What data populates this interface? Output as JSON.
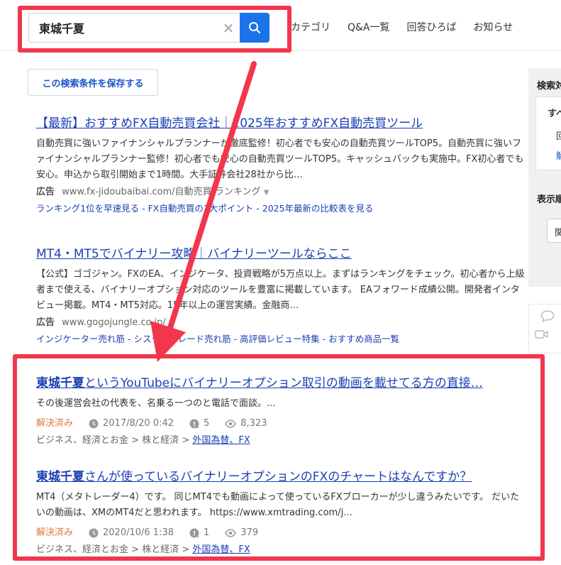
{
  "search": {
    "value": "東城千夏",
    "clear_icon": "×"
  },
  "nav": {
    "items": [
      "カテゴリ",
      "Q&A一覧",
      "回答ひろば",
      "お知らせ"
    ]
  },
  "save_search_label": "この検索条件を保存する",
  "ads": [
    {
      "title": "【最新】おすすめFX自動売買会社｜2025年おすすめFX自動売買ツール",
      "desc": "自動売買に強いファイナンシャルプランナーが徹底監修！初心者でも安心の自動売買ツールTOP5。自動売買に強いファイナンシャルプランナー監修！初心者でも安心の自動売買ツールTOP5。キャッシュバックも実施中。FX初心者でも安心。申込から取引開始まで1時間。大手証券会社28社から比…",
      "ad_label": "広告",
      "url": "www.fx-jidoubaibai.com/自動売買/ランキング",
      "links": [
        "ランキング1位を早速見る",
        "FX自動売買の3大ポイント",
        "2025年最新の比較表を見る"
      ]
    },
    {
      "title": "MT4・MT5でバイナリー攻略｜バイナリーツールならここ",
      "desc": "【公式】ゴゴジャン。FXのEA、インジケータ、投資戦略が5万点以上。まずはランキングをチェック。初心者から上級者まで使える、バイナリーオプション対応のツールを豊富に掲載しています。 EAフォワード成績公開。開発者インタビュー掲載。MT4・MT5対応。15年以上の運営実績。金融商…",
      "ad_label": "広告",
      "url": "www.gogojungle.co.jp/",
      "links": [
        "インジケーター売れ筋",
        "システムトレード売れ筋",
        "高評価レビュー特集",
        "おすすめ商品一覧"
      ]
    }
  ],
  "link_separator": " - ",
  "questions": [
    {
      "title_highlight": "東城千夏",
      "title_rest": "というYouTubeにバイナリーオプション取引の動画を載せてる方の直接…",
      "desc": "その後運営会社の代表を、名乗る一つのと電話で面談。...",
      "status": "解決済み",
      "date": "2017/8/20 0:42",
      "answers": "5",
      "views": "8,323",
      "crumbs": [
        "ビジネス、経済とお金",
        "株と経済"
      ],
      "category_link": "外国為替、FX"
    },
    {
      "title_highlight": "東城千夏",
      "title_rest": "さんが使っているバイナリーオプションのFXのチャートはなんですか？",
      "desc": "MT4（メタトレーダー4）です。 同じMT4でも動画によって使っているFXブローカーが少し違うみたいです。 だいたいの動画は、XMのMT4だと思われます。 https://www.xmtrading.com/j...",
      "status": "解決済み",
      "date": "2020/10/6 1:38",
      "answers": "1",
      "views": "379",
      "crumbs": [
        "ビジネス、経済とお金",
        "株と経済"
      ],
      "category_link": "外国為替、FX"
    }
  ],
  "crumb_separator": " > ",
  "sidebar": {
    "heading": "検索対",
    "box_title": "すべ",
    "box_item": "回",
    "box_link": "解",
    "sort_heading": "表示順",
    "sort_value": "関"
  },
  "colors": {
    "annotation": "#f2364b",
    "link": "#1a3fb3",
    "accent": "#1a73e8",
    "resolved": "#e07b39"
  }
}
